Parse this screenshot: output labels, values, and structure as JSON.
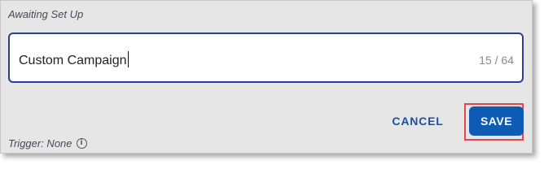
{
  "status": {
    "label": "Awaiting Set Up"
  },
  "campaign_field": {
    "value": "Custom Campaign",
    "char_count": "15 / 64"
  },
  "actions": {
    "cancel_label": "CANCEL",
    "save_label": "SAVE"
  },
  "trigger": {
    "label": "Trigger: None",
    "icon": "info-icon",
    "icon_glyph": "i"
  },
  "colors": {
    "primary": "#0d5bb5",
    "field_border": "#2b3f8f",
    "highlight": "#e4474b"
  }
}
